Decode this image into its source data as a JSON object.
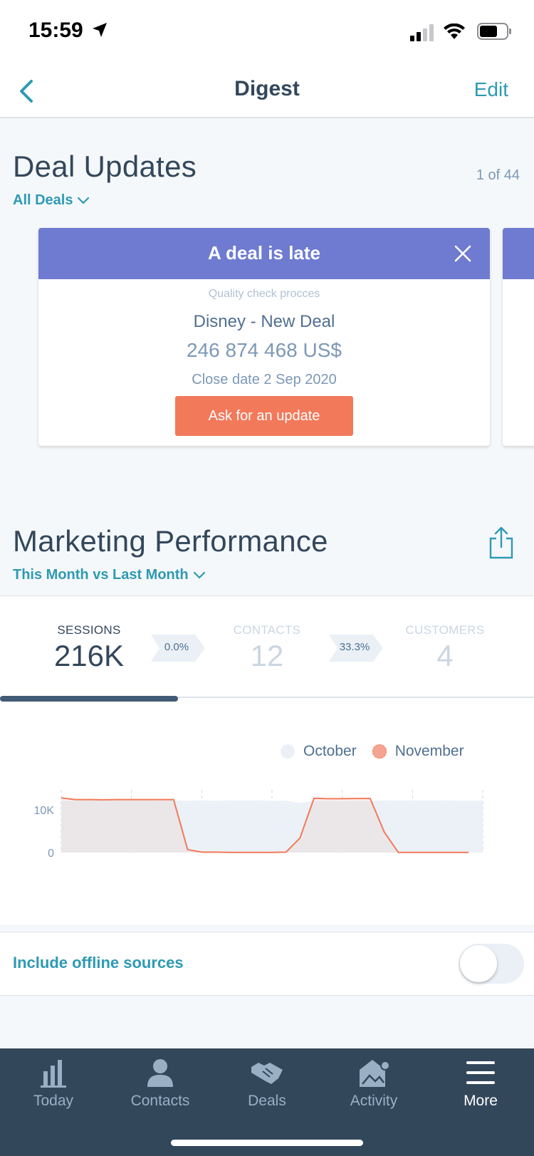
{
  "status": {
    "time": "15:59"
  },
  "nav": {
    "title": "Digest",
    "edit": "Edit"
  },
  "deals": {
    "title": "Deal Updates",
    "filter": "All Deals",
    "pager": "1 of 44",
    "card": {
      "header": "A deal is late",
      "stage": "Quality check procces",
      "name": "Disney - New Deal",
      "amount": "246 874 468 US$",
      "close_date": "Close date 2 Sep 2020",
      "button": "Ask for an update"
    }
  },
  "marketing": {
    "title": "Marketing Performance",
    "filter": "This Month vs Last Month",
    "metrics": [
      {
        "label": "SESSIONS",
        "value": "216K"
      },
      {
        "label": "CONTACTS",
        "value": "12"
      },
      {
        "label": "CUSTOMERS",
        "value": "4"
      }
    ],
    "rates": [
      "0.0%",
      "33.3%"
    ],
    "selected_metric": "SESSIONS",
    "offline_label": "Include offline sources",
    "offline_enabled": false
  },
  "chart_data": {
    "type": "area",
    "y_ticks": [
      "10K",
      "0"
    ],
    "ylim": [
      0,
      13000
    ],
    "legend_position": "top-right",
    "series": [
      {
        "name": "October",
        "color": "#eaf0f6",
        "values": [
          12200,
          12200,
          12200,
          12200,
          12200,
          12200,
          12200,
          12150,
          12200,
          12100,
          12200,
          12100,
          12200,
          12150,
          12200,
          12100,
          12150,
          11600,
          12100,
          12200,
          12100,
          12200,
          12100,
          12200,
          12150,
          12200,
          12150,
          12200,
          12150,
          12150,
          12150
        ]
      },
      {
        "name": "November",
        "color": "#f2795a",
        "values": [
          12800,
          12400,
          12400,
          12350,
          12400,
          12400,
          12400,
          12400,
          12400,
          700,
          100,
          100,
          50,
          50,
          50,
          50,
          100,
          3400,
          12700,
          12600,
          12600,
          12650,
          12650,
          4800,
          50,
          50,
          50,
          50,
          50,
          50
        ]
      }
    ]
  },
  "tabs": [
    {
      "label": "Today",
      "icon": "bar-chart-icon"
    },
    {
      "label": "Contacts",
      "icon": "person-icon"
    },
    {
      "label": "Deals",
      "icon": "handshake-icon"
    },
    {
      "label": "Activity",
      "icon": "activity-icon"
    },
    {
      "label": "More",
      "icon": "menu-icon"
    }
  ],
  "colors": {
    "accent": "#2e9ab3",
    "card_header": "#6e7bd0",
    "button": "#f2795a",
    "tab_bar": "#33475b"
  }
}
